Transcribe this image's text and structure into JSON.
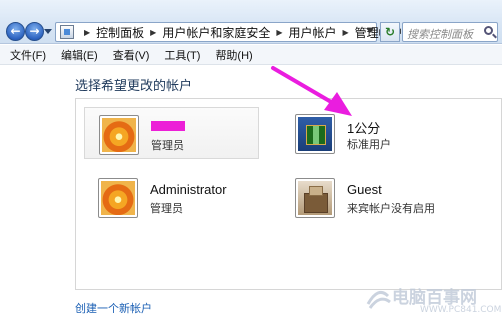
{
  "window": {
    "breadcrumb": [
      "控制面板",
      "用户帐户和家庭安全",
      "用户帐户",
      "管理帐户"
    ],
    "search_placeholder": "搜索控制面板"
  },
  "menu": [
    {
      "label": "文件(F)"
    },
    {
      "label": "编辑(E)"
    },
    {
      "label": "查看(V)"
    },
    {
      "label": "工具(T)"
    },
    {
      "label": "帮助(H)"
    }
  ],
  "main": {
    "heading": "选择希望更改的帐户",
    "accounts": [
      {
        "name": "",
        "type": "管理员",
        "picture": "flower-icon"
      },
      {
        "name": "1公分",
        "type": "标准用户",
        "picture": "chessboard-icon"
      },
      {
        "name": "Administrator",
        "type": "管理员",
        "picture": "flower-icon"
      },
      {
        "name": "Guest",
        "type": "来宾帐户没有启用",
        "picture": "suitcase-icon"
      }
    ],
    "create_link": "创建一个新帐户"
  },
  "overlay": {
    "arrow_color": "#ea1ddf",
    "redaction_color": "#ec1fd7"
  },
  "watermark": {
    "text": "电脑百事网",
    "url": "WWW.PC841.COM"
  }
}
